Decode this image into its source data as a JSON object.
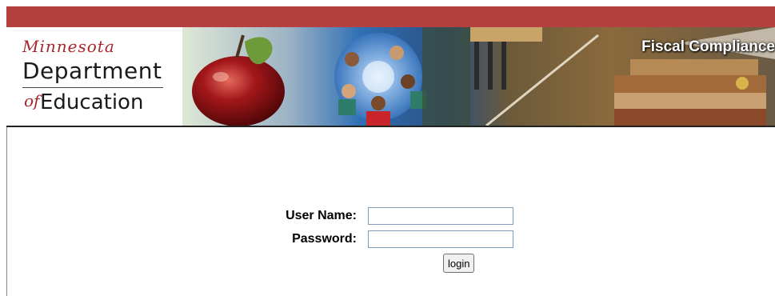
{
  "header": {
    "logo": {
      "state": "Minnesota",
      "line1": "Department",
      "line2_prefix": "of",
      "line2": "Education"
    },
    "title": "Fiscal Compliance",
    "colors": {
      "bar": "#b6403f",
      "logo_red": "#a8262c"
    }
  },
  "login": {
    "username_label": "User Name:",
    "password_label": "Password:",
    "username_value": "",
    "password_value": "",
    "button_label": "login"
  },
  "icons": [
    "apple-icon"
  ]
}
